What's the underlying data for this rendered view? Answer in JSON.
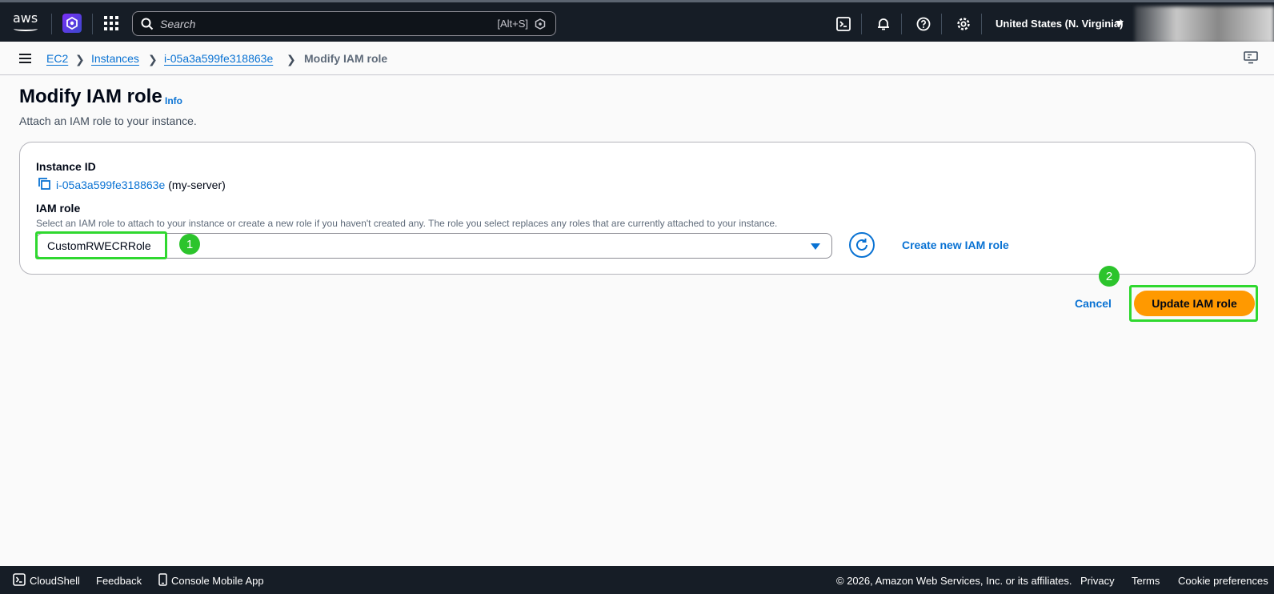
{
  "topnav": {
    "logo_text": "aws",
    "search_placeholder": "Search",
    "search_shortcut": "[Alt+S]",
    "region": "United States (N. Virginia)"
  },
  "breadcrumb": {
    "items": [
      "EC2",
      "Instances",
      "i-05a3a599fe318863e"
    ],
    "current": "Modify IAM role"
  },
  "header": {
    "title": "Modify IAM role",
    "info": "Info",
    "description": "Attach an IAM role to your instance."
  },
  "form": {
    "instance_label": "Instance ID",
    "instance_id": "i-05a3a599fe318863e",
    "instance_name": "(my-server)",
    "role_label": "IAM role",
    "role_description": "Select an IAM role to attach to your instance or create a new role if you haven't created any. The role you select replaces any roles that are currently attached to your instance.",
    "role_value": "CustomRWECRRole",
    "create_link": "Create new IAM role"
  },
  "actions": {
    "cancel": "Cancel",
    "update": "Update IAM role"
  },
  "annotations": [
    "1",
    "2"
  ],
  "colors": {
    "nav_bg": "#161d26",
    "link": "#0972d3",
    "primary_button": "#ff9900",
    "highlight": "#2fd82f"
  },
  "footer": {
    "cloudshell": "CloudShell",
    "feedback": "Feedback",
    "mobile_app": "Console Mobile App",
    "copyright": "© 2026, Amazon Web Services, Inc. or its affiliates.",
    "privacy": "Privacy",
    "terms": "Terms",
    "cookies": "Cookie preferences"
  }
}
